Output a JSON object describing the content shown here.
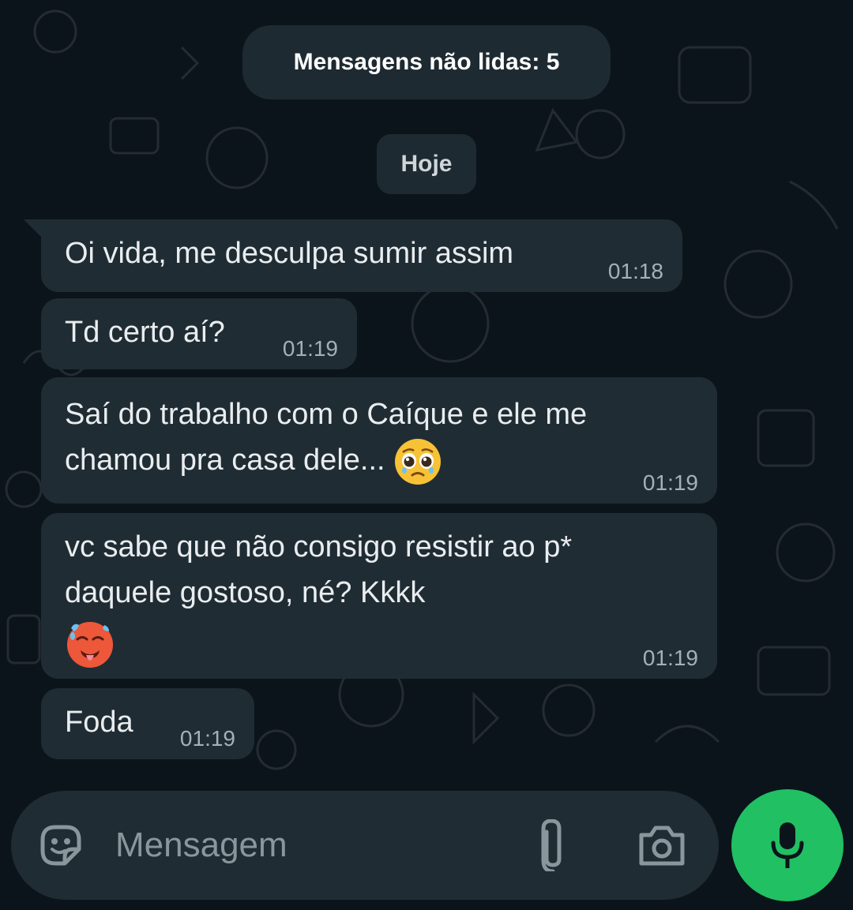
{
  "chat": {
    "unread_banner": "Mensagens não lidas: 5",
    "date_separator": "Hoje",
    "messages": [
      {
        "text": "Oi vida, me desculpa sumir assim",
        "time": "01:18"
      },
      {
        "text": "Td certo aí?",
        "time": "01:19"
      },
      {
        "text": "Saí do trabalho com o Caíque e ele me\nchamou pra casa dele...",
        "emoji": "pleading-face-emoji",
        "time": "01:19"
      },
      {
        "text": "vc sabe que não consigo resistir ao p*\ndaquele gostoso, né? Kkkk",
        "emoji": "hot-face-emoji",
        "time": "01:19"
      },
      {
        "text": "Foda",
        "time": "01:19"
      }
    ]
  },
  "composer": {
    "placeholder": "Mensagem",
    "sticker_icon": "sticker-icon",
    "attach_icon": "paperclip-icon",
    "camera_icon": "camera-icon",
    "mic_icon": "microphone-icon"
  },
  "colors": {
    "background": "#0b141a",
    "bubble": "#202c33",
    "text": "#e9edef",
    "timestamp": "#a5b0b6",
    "accent": "#21c063"
  }
}
